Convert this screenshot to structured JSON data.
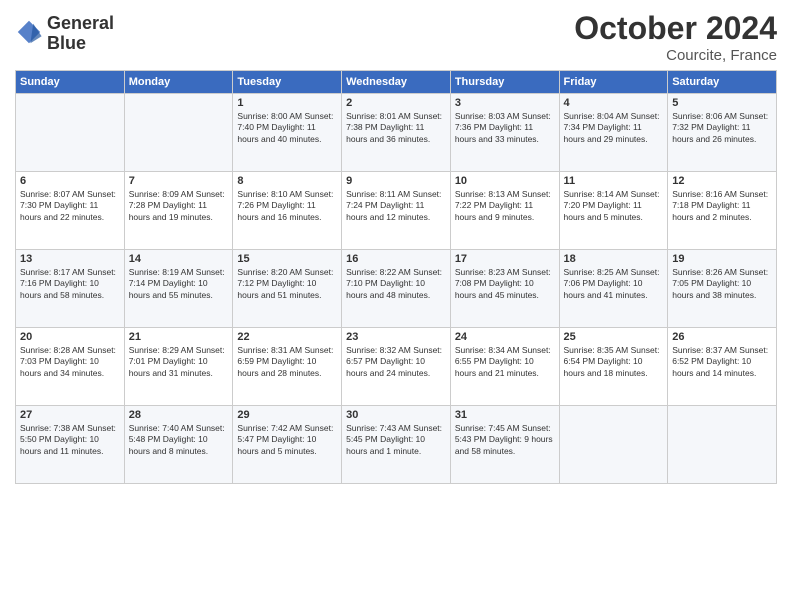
{
  "header": {
    "logo_line1": "General",
    "logo_line2": "Blue",
    "month": "October 2024",
    "location": "Courcite, France"
  },
  "weekdays": [
    "Sunday",
    "Monday",
    "Tuesday",
    "Wednesday",
    "Thursday",
    "Friday",
    "Saturday"
  ],
  "weeks": [
    [
      {
        "day": "",
        "info": ""
      },
      {
        "day": "",
        "info": ""
      },
      {
        "day": "1",
        "info": "Sunrise: 8:00 AM\nSunset: 7:40 PM\nDaylight: 11 hours\nand 40 minutes."
      },
      {
        "day": "2",
        "info": "Sunrise: 8:01 AM\nSunset: 7:38 PM\nDaylight: 11 hours\nand 36 minutes."
      },
      {
        "day": "3",
        "info": "Sunrise: 8:03 AM\nSunset: 7:36 PM\nDaylight: 11 hours\nand 33 minutes."
      },
      {
        "day": "4",
        "info": "Sunrise: 8:04 AM\nSunset: 7:34 PM\nDaylight: 11 hours\nand 29 minutes."
      },
      {
        "day": "5",
        "info": "Sunrise: 8:06 AM\nSunset: 7:32 PM\nDaylight: 11 hours\nand 26 minutes."
      }
    ],
    [
      {
        "day": "6",
        "info": "Sunrise: 8:07 AM\nSunset: 7:30 PM\nDaylight: 11 hours\nand 22 minutes."
      },
      {
        "day": "7",
        "info": "Sunrise: 8:09 AM\nSunset: 7:28 PM\nDaylight: 11 hours\nand 19 minutes."
      },
      {
        "day": "8",
        "info": "Sunrise: 8:10 AM\nSunset: 7:26 PM\nDaylight: 11 hours\nand 16 minutes."
      },
      {
        "day": "9",
        "info": "Sunrise: 8:11 AM\nSunset: 7:24 PM\nDaylight: 11 hours\nand 12 minutes."
      },
      {
        "day": "10",
        "info": "Sunrise: 8:13 AM\nSunset: 7:22 PM\nDaylight: 11 hours\nand 9 minutes."
      },
      {
        "day": "11",
        "info": "Sunrise: 8:14 AM\nSunset: 7:20 PM\nDaylight: 11 hours\nand 5 minutes."
      },
      {
        "day": "12",
        "info": "Sunrise: 8:16 AM\nSunset: 7:18 PM\nDaylight: 11 hours\nand 2 minutes."
      }
    ],
    [
      {
        "day": "13",
        "info": "Sunrise: 8:17 AM\nSunset: 7:16 PM\nDaylight: 10 hours\nand 58 minutes."
      },
      {
        "day": "14",
        "info": "Sunrise: 8:19 AM\nSunset: 7:14 PM\nDaylight: 10 hours\nand 55 minutes."
      },
      {
        "day": "15",
        "info": "Sunrise: 8:20 AM\nSunset: 7:12 PM\nDaylight: 10 hours\nand 51 minutes."
      },
      {
        "day": "16",
        "info": "Sunrise: 8:22 AM\nSunset: 7:10 PM\nDaylight: 10 hours\nand 48 minutes."
      },
      {
        "day": "17",
        "info": "Sunrise: 8:23 AM\nSunset: 7:08 PM\nDaylight: 10 hours\nand 45 minutes."
      },
      {
        "day": "18",
        "info": "Sunrise: 8:25 AM\nSunset: 7:06 PM\nDaylight: 10 hours\nand 41 minutes."
      },
      {
        "day": "19",
        "info": "Sunrise: 8:26 AM\nSunset: 7:05 PM\nDaylight: 10 hours\nand 38 minutes."
      }
    ],
    [
      {
        "day": "20",
        "info": "Sunrise: 8:28 AM\nSunset: 7:03 PM\nDaylight: 10 hours\nand 34 minutes."
      },
      {
        "day": "21",
        "info": "Sunrise: 8:29 AM\nSunset: 7:01 PM\nDaylight: 10 hours\nand 31 minutes."
      },
      {
        "day": "22",
        "info": "Sunrise: 8:31 AM\nSunset: 6:59 PM\nDaylight: 10 hours\nand 28 minutes."
      },
      {
        "day": "23",
        "info": "Sunrise: 8:32 AM\nSunset: 6:57 PM\nDaylight: 10 hours\nand 24 minutes."
      },
      {
        "day": "24",
        "info": "Sunrise: 8:34 AM\nSunset: 6:55 PM\nDaylight: 10 hours\nand 21 minutes."
      },
      {
        "day": "25",
        "info": "Sunrise: 8:35 AM\nSunset: 6:54 PM\nDaylight: 10 hours\nand 18 minutes."
      },
      {
        "day": "26",
        "info": "Sunrise: 8:37 AM\nSunset: 6:52 PM\nDaylight: 10 hours\nand 14 minutes."
      }
    ],
    [
      {
        "day": "27",
        "info": "Sunrise: 7:38 AM\nSunset: 5:50 PM\nDaylight: 10 hours\nand 11 minutes."
      },
      {
        "day": "28",
        "info": "Sunrise: 7:40 AM\nSunset: 5:48 PM\nDaylight: 10 hours\nand 8 minutes."
      },
      {
        "day": "29",
        "info": "Sunrise: 7:42 AM\nSunset: 5:47 PM\nDaylight: 10 hours\nand 5 minutes."
      },
      {
        "day": "30",
        "info": "Sunrise: 7:43 AM\nSunset: 5:45 PM\nDaylight: 10 hours\nand 1 minute."
      },
      {
        "day": "31",
        "info": "Sunrise: 7:45 AM\nSunset: 5:43 PM\nDaylight: 9 hours\nand 58 minutes."
      },
      {
        "day": "",
        "info": ""
      },
      {
        "day": "",
        "info": ""
      }
    ]
  ]
}
